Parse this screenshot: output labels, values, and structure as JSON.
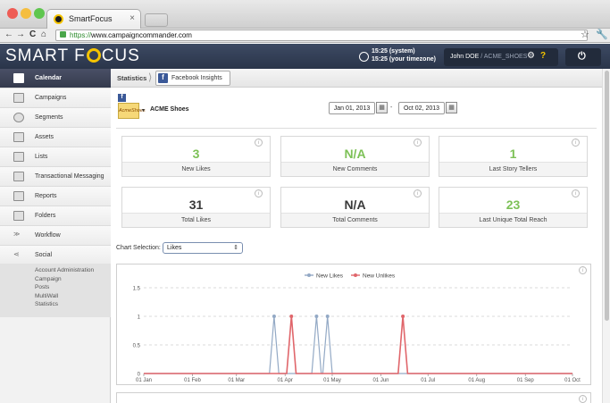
{
  "browser": {
    "tab_title": "SmartFocus",
    "tab_close": "×",
    "url_scheme": "https://",
    "url_rest": "www.campaigncommander.com",
    "back": "←",
    "forward": "→",
    "reload": "C",
    "home": "⌂",
    "star": "☆",
    "wrench": "🔧",
    "colors": {
      "close": "#ee5c55",
      "minimize": "#f5be3f",
      "zoom": "#5fc64f"
    }
  },
  "header": {
    "logo_left": "SMART F",
    "logo_right": "CUS",
    "time_system": "15:25 (system)",
    "time_timezone": "15:25 (your timezone)",
    "user_name": "John DOE",
    "user_sep": " / ",
    "user_account": "ACME_SHOES",
    "gear": "⚙",
    "help": "?",
    "power": "⏻"
  },
  "sidebar": {
    "items": [
      {
        "label": "Calendar",
        "icon": "calendar-icon"
      },
      {
        "label": "Campaigns",
        "icon": "campaigns-icon"
      },
      {
        "label": "Segments",
        "icon": "segments-icon"
      },
      {
        "label": "Assets",
        "icon": "assets-icon"
      },
      {
        "label": "Lists",
        "icon": "lists-icon"
      },
      {
        "label": "Transactional Messaging",
        "icon": "transactional-icon"
      },
      {
        "label": "Reports",
        "icon": "reports-icon"
      },
      {
        "label": "Folders",
        "icon": "folders-icon"
      },
      {
        "label": "Workflow",
        "icon": "workflow-icon"
      },
      {
        "label": "Social",
        "icon": "social-icon"
      }
    ],
    "sub_items": [
      "Account Administration",
      "Campaign",
      "Posts",
      "MultiWall",
      "Statistics"
    ]
  },
  "breadcrumb": {
    "root": "Statistics",
    "arrow": "⟩",
    "current": "Facebook Insights",
    "fb": "f"
  },
  "account": {
    "fb": "f",
    "logo_text": "AcmeShoes",
    "caret": "▾",
    "name": "ACME Shoes"
  },
  "dates": {
    "start": "Jan 01, 2013",
    "end": "Oct 02, 2013",
    "dash": "-",
    "cal": "▦"
  },
  "cards": [
    {
      "value": "3",
      "label": "New Likes",
      "info": "i"
    },
    {
      "value": "N/A",
      "label": "New Comments",
      "info": "i"
    },
    {
      "value": "1",
      "label": "Last Story Tellers",
      "info": "i"
    },
    {
      "value": "31",
      "label": "Total Likes",
      "info": "i"
    },
    {
      "value": "N/A",
      "label": "Total Comments",
      "info": "i"
    },
    {
      "value": "23",
      "label": "Last Unique Total Reach",
      "info": "i"
    }
  ],
  "chart_selection": {
    "label": "Chart Selection:",
    "value": "Likes",
    "caret": "⇕"
  },
  "chart_data": {
    "type": "line",
    "series": [
      {
        "name": "New Likes",
        "color": "#93a9c5",
        "points": [
          [
            "2013-03-25",
            1
          ],
          [
            "2013-04-21",
            1
          ],
          [
            "2013-04-28",
            1
          ]
        ]
      },
      {
        "name": "New Unlikes",
        "color": "#e0666b",
        "points": [
          [
            "2013-04-05",
            1
          ],
          [
            "2013-06-15",
            1
          ]
        ]
      }
    ],
    "x_ticks": [
      "01 Jan",
      "01 Feb",
      "01 Mar",
      "01 Apr",
      "01 May",
      "01 Jun",
      "01 Jul",
      "01 Aug",
      "01 Sep",
      "01 Oct"
    ],
    "xlim": [
      "2013-01-01",
      "2013-10-01"
    ],
    "y_ticks": [
      "0",
      "0.5",
      "1",
      "1.5"
    ],
    "ylim": [
      0,
      1.5
    ],
    "grid": true,
    "legend": "top-center",
    "info": "i"
  },
  "chart2": {
    "info": "i"
  }
}
